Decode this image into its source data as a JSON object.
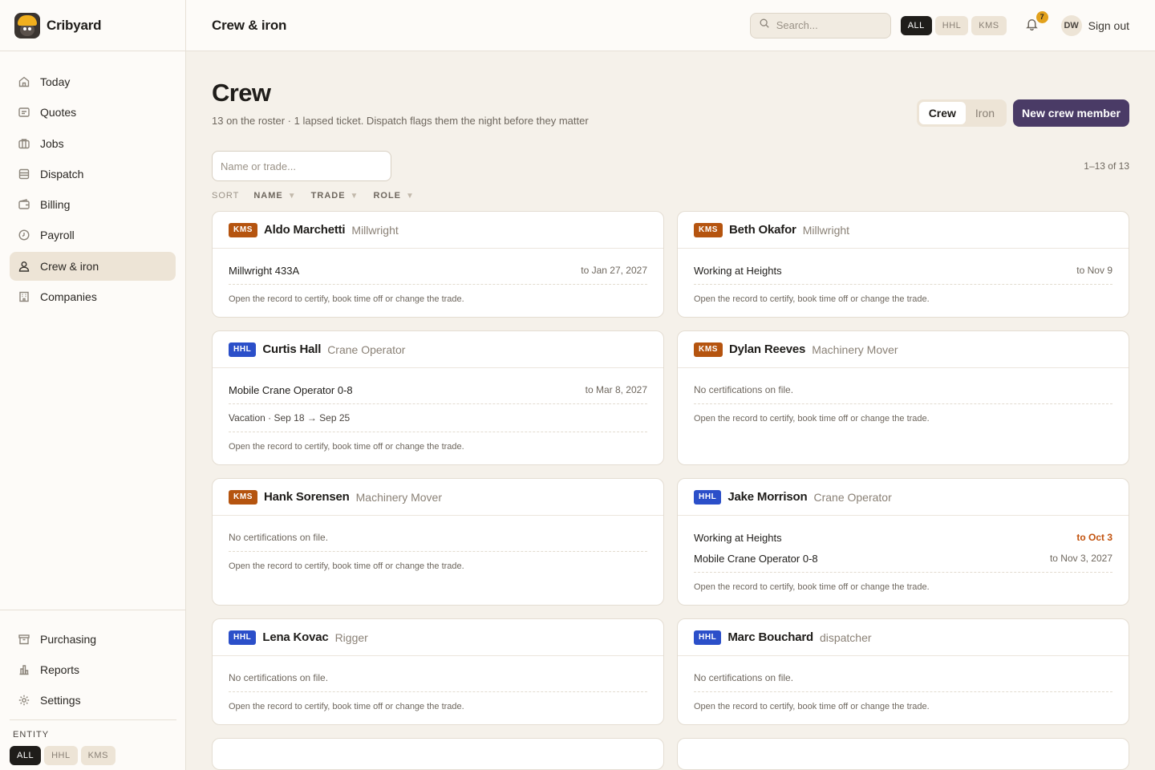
{
  "app": {
    "name": "Cribyard"
  },
  "sidebar": {
    "items": [
      {
        "label": "Today",
        "icon": "home-icon",
        "active": false
      },
      {
        "label": "Quotes",
        "icon": "quote-icon",
        "active": false
      },
      {
        "label": "Jobs",
        "icon": "briefcase-icon",
        "active": false
      },
      {
        "label": "Dispatch",
        "icon": "dispatch-icon",
        "active": false
      },
      {
        "label": "Billing",
        "icon": "wallet-icon",
        "active": false
      },
      {
        "label": "Payroll",
        "icon": "clock-icon",
        "active": false
      },
      {
        "label": "Crew & iron",
        "icon": "user-icon",
        "active": true
      },
      {
        "label": "Companies",
        "icon": "building-icon",
        "active": false
      }
    ],
    "bottom_items": [
      {
        "label": "Purchasing",
        "icon": "archive-icon"
      },
      {
        "label": "Reports",
        "icon": "chart-icon"
      },
      {
        "label": "Settings",
        "icon": "gear-icon"
      }
    ],
    "entity": {
      "label": "ENTITY",
      "options": [
        "ALL",
        "HHL",
        "KMS"
      ],
      "selected": "ALL"
    }
  },
  "topbar": {
    "title": "Crew & iron",
    "search_placeholder": "Search...",
    "entity_options": [
      "ALL",
      "HHL",
      "KMS"
    ],
    "entity_selected": "ALL",
    "notifications": "7",
    "user_initials": "DW",
    "signout": "Sign out"
  },
  "page": {
    "title": "Crew",
    "subtitle": "13 on the roster · 1 lapsed ticket. Dispatch flags them the night before they matter",
    "toggle": {
      "crew": "Crew",
      "iron": "Iron",
      "selected": "Crew"
    },
    "new_button": "New crew member",
    "filter_placeholder": "Name or trade...",
    "count": "1–13 of 13",
    "sort": {
      "label": "SORT",
      "options": [
        "NAME",
        "TRADE",
        "ROLE"
      ]
    }
  },
  "crew": [
    {
      "entity": "KMS",
      "name": "Aldo Marchetti",
      "trade": "Millwright",
      "certs": [
        {
          "name": "Millwright 433A",
          "until": "to Jan 27, 2027",
          "warn": false
        }
      ],
      "leave": null,
      "footer": "Open the record to certify, book time off or change the trade."
    },
    {
      "entity": "KMS",
      "name": "Beth Okafor",
      "trade": "Millwright",
      "certs": [
        {
          "name": "Working at Heights",
          "until": "to Nov 9",
          "warn": false
        }
      ],
      "leave": null,
      "footer": "Open the record to certify, book time off or change the trade."
    },
    {
      "entity": "HHL",
      "name": "Curtis Hall",
      "trade": "Crane Operator",
      "certs": [
        {
          "name": "Mobile Crane Operator 0-8",
          "until": "to Mar 8, 2027",
          "warn": false
        }
      ],
      "leave": "Vacation · Sep 18 → Sep 25",
      "footer": "Open the record to certify, book time off or change the trade."
    },
    {
      "entity": "KMS",
      "name": "Dylan Reeves",
      "trade": "Machinery Mover",
      "certs": [],
      "empty": "No certifications on file.",
      "leave": null,
      "footer": "Open the record to certify, book time off or change the trade."
    },
    {
      "entity": "KMS",
      "name": "Hank Sorensen",
      "trade": "Machinery Mover",
      "certs": [],
      "empty": "No certifications on file.",
      "leave": null,
      "footer": "Open the record to certify, book time off or change the trade."
    },
    {
      "entity": "HHL",
      "name": "Jake Morrison",
      "trade": "Crane Operator",
      "certs": [
        {
          "name": "Working at Heights",
          "until": "to Oct 3",
          "warn": true
        },
        {
          "name": "Mobile Crane Operator 0-8",
          "until": "to Nov 3, 2027",
          "warn": false
        }
      ],
      "leave": null,
      "footer": "Open the record to certify, book time off or change the trade."
    },
    {
      "entity": "HHL",
      "name": "Lena Kovac",
      "trade": "Rigger",
      "certs": [],
      "empty": "No certifications on file.",
      "leave": null,
      "footer": "Open the record to certify, book time off or change the trade."
    },
    {
      "entity": "HHL",
      "name": "Marc Bouchard",
      "trade": "dispatcher",
      "certs": [],
      "empty": "No certifications on file.",
      "leave": null,
      "footer": "Open the record to certify, book time off or change the trade."
    }
  ],
  "colors": {
    "accent": "#4a3b66",
    "kms": "#b5540f",
    "hhl": "#2b4fc9",
    "warn": "#c2520d",
    "badge": "#e2a11c"
  }
}
